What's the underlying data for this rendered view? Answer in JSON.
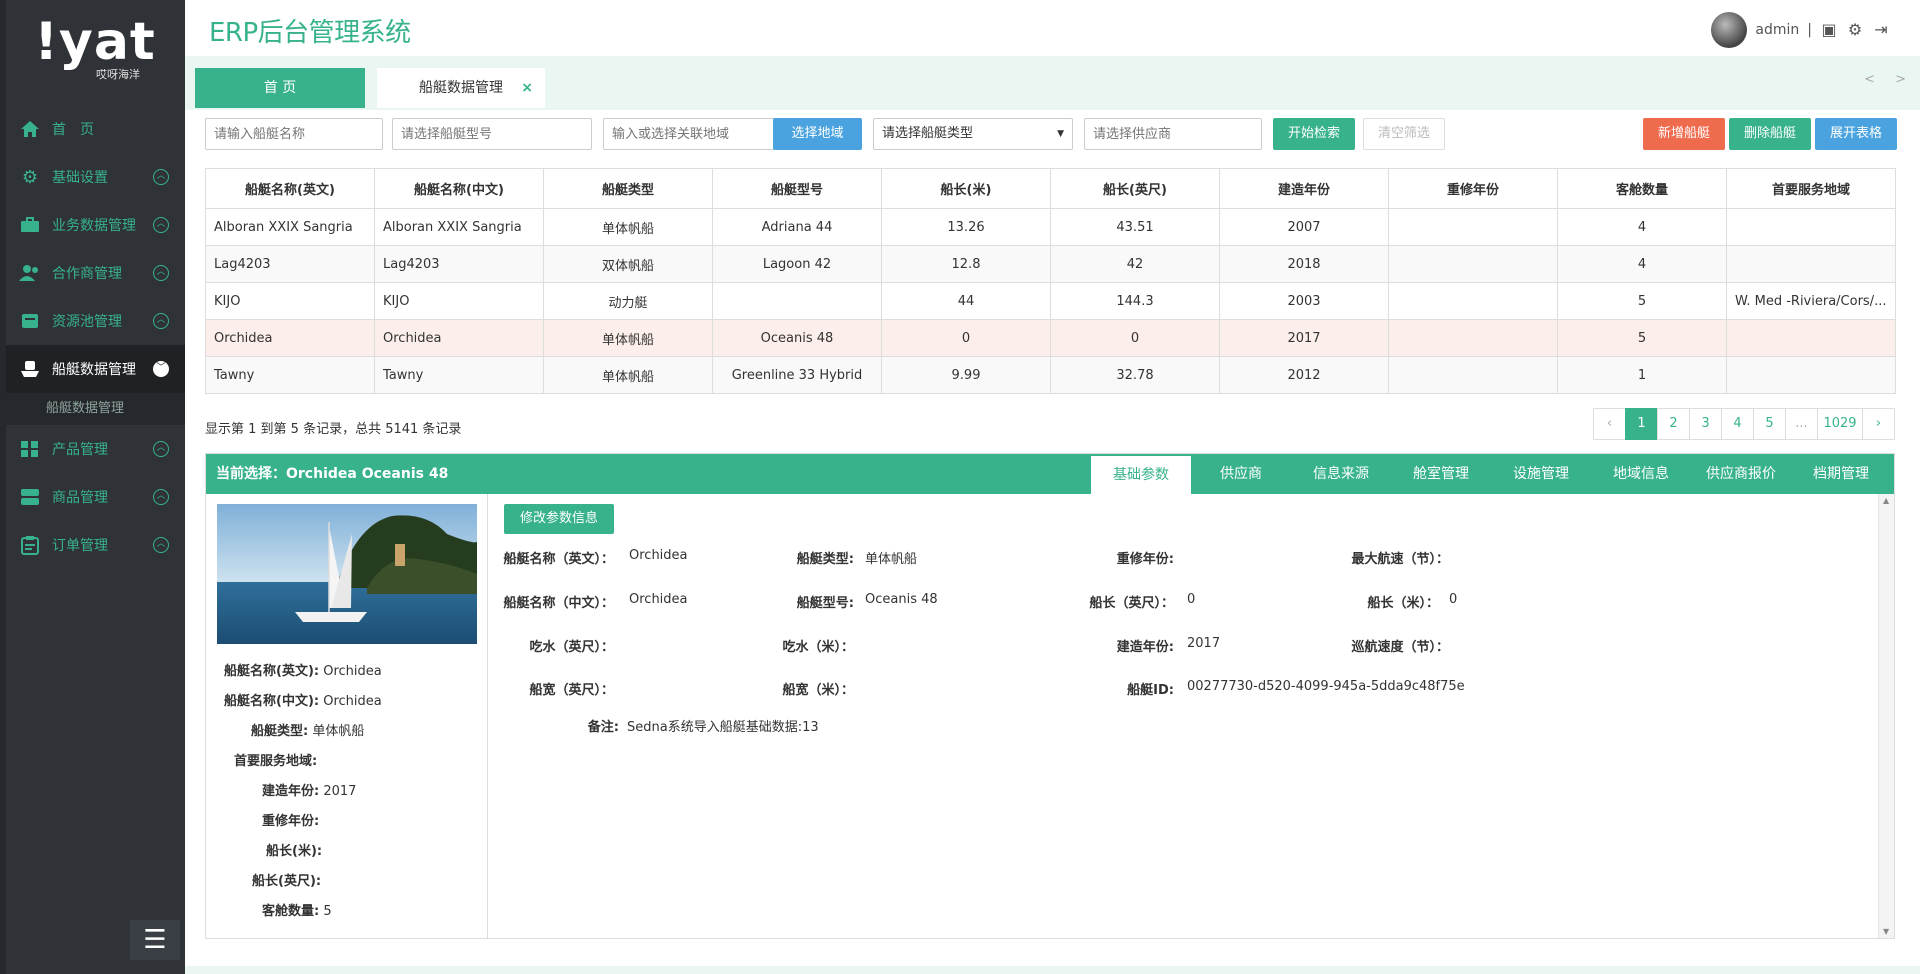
{
  "brand": {
    "logo_big": "!yat",
    "logo_small": "哎呀海洋"
  },
  "app_title": "ERP后台管理系统",
  "user": {
    "name": "admin",
    "separator": "|"
  },
  "sidebar": {
    "items": [
      {
        "label": "首　页",
        "icon": "home-icon"
      },
      {
        "label": "基础设置",
        "icon": "gear-icon"
      },
      {
        "label": "业务数据管理",
        "icon": "briefcase-icon"
      },
      {
        "label": "合作商管理",
        "icon": "users-icon"
      },
      {
        "label": "资源池管理",
        "icon": "database-icon"
      },
      {
        "label": "船艇数据管理",
        "icon": "ship-icon"
      },
      {
        "label": "产品管理",
        "icon": "grid-icon"
      },
      {
        "label": "商品管理",
        "icon": "server-icon"
      },
      {
        "label": "订单管理",
        "icon": "clipboard-icon"
      }
    ],
    "submenu": "船艇数据管理"
  },
  "tabs": {
    "home": "首 页",
    "current": "船艇数据管理",
    "close": "×",
    "nav": "< >"
  },
  "filters": {
    "name_placeholder": "请输入船艇名称",
    "model_placeholder": "请选择船艇型号",
    "region_placeholder": "输入或选择关联地域",
    "region_btn": "选择地域",
    "type_select": "请选择船艇类型",
    "supplier_placeholder": "请选择供应商",
    "search_btn": "开始检索",
    "clear_btn": "清空筛选",
    "add_btn": "新增船艇",
    "delete_btn": "删除船艇",
    "expand_btn": "展开表格"
  },
  "table": {
    "headers": [
      "船艇名称(英文)",
      "船艇名称(中文)",
      "船艇类型",
      "船艇型号",
      "船长(米)",
      "船长(英尺)",
      "建造年份",
      "重修年份",
      "客舱数量",
      "首要服务地域"
    ],
    "rows": [
      [
        "Alboran XXIX Sangria",
        "Alboran XXIX Sangria",
        "单体帆船",
        "Adriana 44",
        "13.26",
        "43.51",
        "2007",
        "",
        "4",
        ""
      ],
      [
        "Lag4203",
        "Lag4203",
        "双体帆船",
        "Lagoon 42",
        "12.8",
        "42",
        "2018",
        "",
        "4",
        ""
      ],
      [
        "KIJO",
        "KIJO",
        "动力艇",
        "",
        "44",
        "144.3",
        "2003",
        "",
        "5",
        "W. Med -Riviera/Cors/..."
      ],
      [
        "Orchidea",
        "Orchidea",
        "单体帆船",
        "Oceanis 48",
        "0",
        "0",
        "2017",
        "",
        "5",
        ""
      ],
      [
        "Tawny",
        "Tawny",
        "单体帆船",
        "Greenline 33 Hybrid",
        "9.99",
        "32.78",
        "2012",
        "",
        "1",
        ""
      ]
    ]
  },
  "pagination": {
    "info": "显示第 1 到第 5 条记录，总共 5141 条记录",
    "pages": [
      "‹",
      "1",
      "2",
      "3",
      "4",
      "5",
      "...",
      "1029",
      "›"
    ]
  },
  "detail": {
    "title": "当前选择：Orchidea Oceanis 48",
    "tabs": [
      "基础参数",
      "供应商",
      "信息来源",
      "舱室管理",
      "设施管理",
      "地域信息",
      "供应商报价",
      "档期管理"
    ],
    "edit_btn": "修改参数信息",
    "summary": [
      {
        "label": "船艇名称(英文):",
        "value": "Orchidea"
      },
      {
        "label": "船艇名称(中文):",
        "value": "Orchidea"
      },
      {
        "label": "船艇类型:",
        "value": "单体帆船"
      },
      {
        "label": "首要服务地域:",
        "value": ""
      },
      {
        "label": "建造年份:",
        "value": "2017"
      },
      {
        "label": "重修年份:",
        "value": ""
      },
      {
        "label": "船长(米):",
        "value": ""
      },
      {
        "label": "船长(英尺):",
        "value": ""
      },
      {
        "label": "客舱数量:",
        "value": "5"
      }
    ],
    "fields": {
      "name_en_label": "船艇名称（英文）：",
      "name_en": "Orchidea",
      "type_label": "船艇类型:",
      "type": "单体帆船",
      "refit_label": "重修年份:",
      "refit": "",
      "max_speed_label": "最大航速（节）：",
      "max_speed": "",
      "name_cn_label": "船艇名称（中文）：",
      "name_cn": "Orchidea",
      "model_label": "船艇型号:",
      "model": "Oceanis 48",
      "len_ft_label": "船长（英尺）：",
      "len_ft": "0",
      "len_m_label": "船长（米）：",
      "len_m": "0",
      "draft_ft_label": "吃水（英尺）：",
      "draft_ft": "",
      "draft_m_label": "吃水（米）：",
      "draft_m": "",
      "built_label": "建造年份:",
      "built": "2017",
      "cruise_label": "巡航速度（节）：",
      "cruise": "",
      "beam_ft_label": "船宽（英尺）：",
      "beam_ft": "",
      "beam_m_label": "船宽（米）：",
      "beam_m": "",
      "id_label": "船艇ID:",
      "id": "00277730-d520-4099-945a-5dda9c48f75e",
      "note_label": "备注:",
      "note": "Sedna系统导入船艇基础数据:13"
    }
  },
  "colors": {
    "accent": "#37b28c",
    "sidebar": "#2f3338",
    "danger": "#ef6b4e",
    "info": "#4aa3df"
  }
}
